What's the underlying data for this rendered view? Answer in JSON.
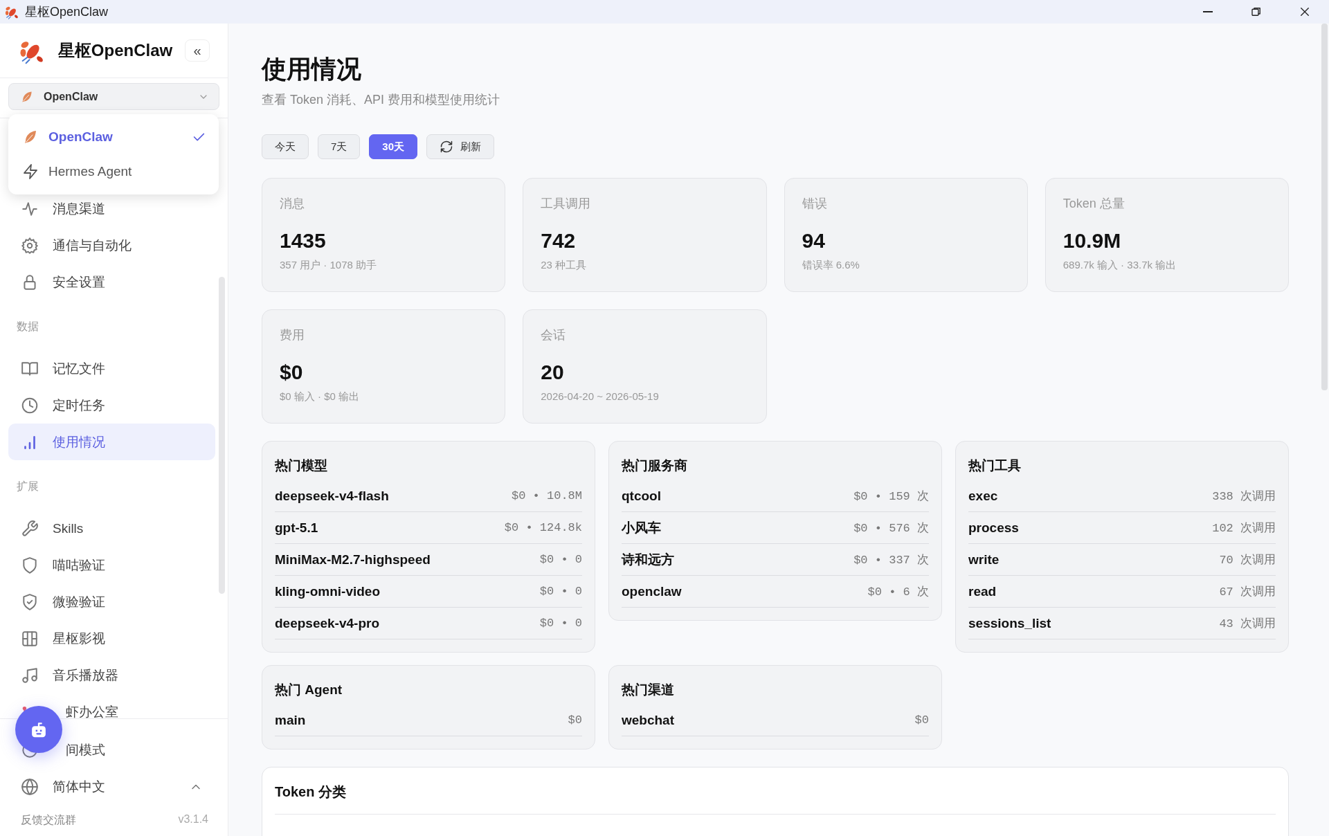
{
  "window": {
    "title": "星枢OpenClaw"
  },
  "sidebar": {
    "brand": "星枢OpenClaw",
    "collapse_label": "«",
    "agent_select": {
      "value": "OpenClaw"
    },
    "agent_menu": [
      {
        "label": "OpenClaw",
        "selected": true
      },
      {
        "label": "Hermes Agent",
        "selected": false
      }
    ],
    "nav": [
      {
        "items": [
          {
            "label": "消息渠道",
            "selected": false
          },
          {
            "label": "通信与自动化",
            "selected": false
          },
          {
            "label": "安全设置",
            "selected": false
          }
        ]
      },
      {
        "heading": "数据",
        "items": [
          {
            "label": "记忆文件",
            "selected": false
          },
          {
            "label": "定时任务",
            "selected": false
          },
          {
            "label": "使用情况",
            "selected": true
          }
        ]
      },
      {
        "heading": "扩展",
        "items": [
          {
            "label": "Skills",
            "selected": false
          },
          {
            "label": "喵咕验证",
            "selected": false
          },
          {
            "label": "微验验证",
            "selected": false
          },
          {
            "label": "星枢影视",
            "selected": false
          },
          {
            "label": "音乐播放器",
            "selected": false
          },
          {
            "label": "虾办公室",
            "selected": false
          }
        ]
      }
    ],
    "night_mode": {
      "label": "间模式"
    },
    "language": {
      "label": "简体中文"
    },
    "footer": {
      "feedback": "反馈交流群",
      "version": "v3.1.4"
    }
  },
  "main": {
    "title": "使用情况",
    "subtitle": "查看 Token 消耗、API 费用和模型使用统计",
    "ranges": [
      {
        "label": "今天",
        "selected": false
      },
      {
        "label": "7天",
        "selected": false
      },
      {
        "label": "30天",
        "selected": true
      }
    ],
    "refresh_label": "刷新",
    "stats": [
      {
        "label": "消息",
        "value": "1435",
        "detail": "357 用户 · 1078 助手"
      },
      {
        "label": "工具调用",
        "value": "742",
        "detail": "23 种工具"
      },
      {
        "label": "错误",
        "value": "94",
        "detail": "错误率 6.6%"
      },
      {
        "label": "Token 总量",
        "value": "10.9M",
        "detail": "689.7k 输入 · 33.7k 输出"
      },
      {
        "label": "费用",
        "value": "$0",
        "detail": "$0 输入 · $0 输出"
      },
      {
        "label": "会话",
        "value": "20",
        "detail": "2026-04-20 ~ 2026-05-19"
      }
    ],
    "rankings": [
      {
        "title": "热门模型",
        "rows": [
          {
            "name": "deepseek-v4-flash",
            "value": "$0 • 10.8M"
          },
          {
            "name": "gpt-5.1",
            "value": "$0 • 124.8k"
          },
          {
            "name": "MiniMax-M2.7-highspeed",
            "value": "$0 • 0"
          },
          {
            "name": "kling-omni-video",
            "value": "$0 • 0"
          },
          {
            "name": "deepseek-v4-pro",
            "value": "$0 • 0"
          }
        ]
      },
      {
        "title": "热门服务商",
        "rows": [
          {
            "name": "qtcool",
            "value": "$0 • 159 次"
          },
          {
            "name": "小风车",
            "value": "$0 • 576 次"
          },
          {
            "name": "诗和远方",
            "value": "$0 • 337 次"
          },
          {
            "name": "openclaw",
            "value": "$0 • 6 次"
          }
        ]
      },
      {
        "title": "热门工具",
        "rows": [
          {
            "name": "exec",
            "value": "338 次调用"
          },
          {
            "name": "process",
            "value": "102 次调用"
          },
          {
            "name": "write",
            "value": "70 次调用"
          },
          {
            "name": "read",
            "value": "67 次调用"
          },
          {
            "name": "sessions_list",
            "value": "43 次调用"
          }
        ]
      },
      {
        "title": "热门 Agent",
        "rows": [
          {
            "name": "main",
            "value": "$0"
          }
        ]
      },
      {
        "title": "热门渠道",
        "rows": [
          {
            "name": "webchat",
            "value": "$0"
          }
        ]
      }
    ],
    "token_breakdown": {
      "title": "Token 分类"
    }
  }
}
